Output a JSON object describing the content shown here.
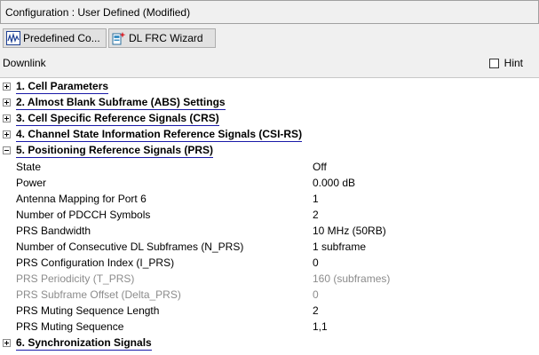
{
  "title": "Configuration : User Defined (Modified)",
  "toolbar": {
    "predefined_label": "Predefined Co...",
    "wizard_label": "DL FRC Wizard"
  },
  "downlink_label": "Downlink",
  "hint_label": "Hint",
  "hint_checked": false,
  "sections": [
    {
      "label": "1. Cell Parameters",
      "expanded": false
    },
    {
      "label": "2. Almost Blank Subframe (ABS) Settings",
      "expanded": false
    },
    {
      "label": "3. Cell Specific Reference Signals (CRS)",
      "expanded": false
    },
    {
      "label": "4. Channel State Information Reference Signals (CSI-RS)",
      "expanded": false
    },
    {
      "label": "5. Positioning Reference Signals (PRS)",
      "expanded": true
    },
    {
      "label": "6. Synchronization Signals",
      "expanded": false
    }
  ],
  "prs_params": [
    {
      "name": "State",
      "value": "Off",
      "enabled": true
    },
    {
      "name": "Power",
      "value": "0.000 dB",
      "enabled": true
    },
    {
      "name": "Antenna Mapping for Port 6",
      "value": "1",
      "enabled": true
    },
    {
      "name": "Number of PDCCH Symbols",
      "value": "2",
      "enabled": true
    },
    {
      "name": "PRS Bandwidth",
      "value": "10 MHz (50RB)",
      "enabled": true
    },
    {
      "name": "Number of Consecutive DL Subframes (N_PRS)",
      "value": "1 subframe",
      "enabled": true
    },
    {
      "name": "PRS Configuration Index (I_PRS)",
      "value": "0",
      "enabled": true
    },
    {
      "name": "PRS Periodicity (T_PRS)",
      "value": "160 (subframes)",
      "enabled": false
    },
    {
      "name": "PRS Subframe Offset (Delta_PRS)",
      "value": "0",
      "enabled": false
    },
    {
      "name": "PRS Muting Sequence Length",
      "value": "2",
      "enabled": true
    },
    {
      "name": "PRS Muting Sequence",
      "value": "1,1",
      "enabled": true
    }
  ]
}
